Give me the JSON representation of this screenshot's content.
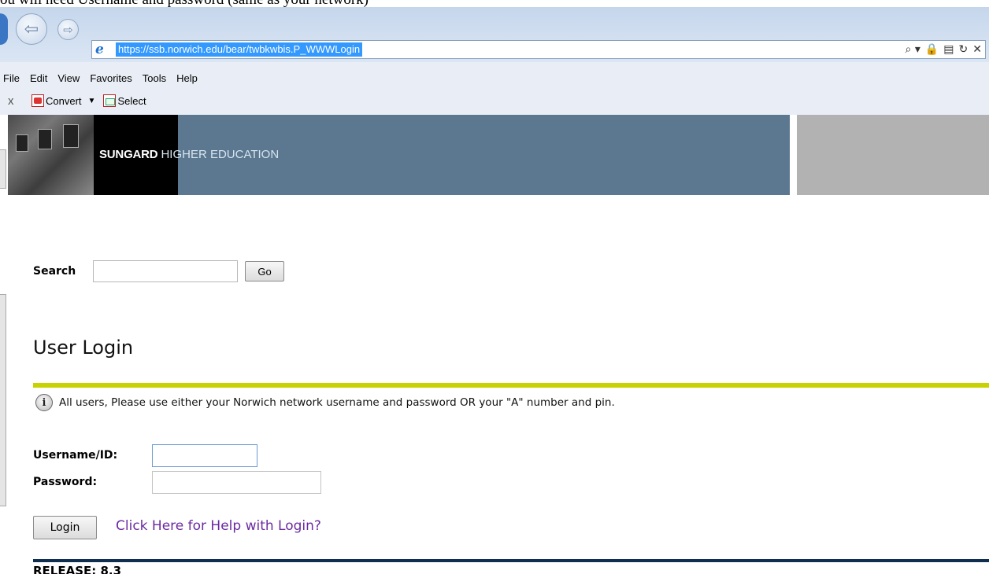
{
  "document_strip": {
    "text": "ou will need Username and password (same as your network)"
  },
  "browser": {
    "url": "https://ssb.norwich.edu/bear/twbkwbis.P_WWWLogin",
    "address_tools": [
      "⌕ ▾",
      "🔒",
      "▤",
      "↻",
      "✕"
    ],
    "menu": [
      "File",
      "Edit",
      "View",
      "Favorites",
      "Tools",
      "Help"
    ],
    "command_bar": {
      "close": "x",
      "convert_label": "Convert",
      "select_label": "Select"
    }
  },
  "banner": {
    "brand_bold": "SUNGARD",
    "brand_sub": "HIGHER EDUCATION"
  },
  "search": {
    "label": "Search",
    "value": "",
    "go_label": "Go"
  },
  "login": {
    "title": "User Login",
    "info": "All users, Please use either your Norwich network username and password OR your \"A\" number and pin.",
    "username_label": "Username/ID:",
    "username_value": "",
    "password_label": "Password:",
    "password_value": "",
    "login_label": "Login",
    "help_link": "Click Here for Help with Login?"
  },
  "footer": {
    "release": "RELEASE: 8.3"
  },
  "colors": {
    "banner_blue": "#5b7890",
    "title_rule": "#c7d200",
    "footer_rule": "#0f2e50",
    "link": "#6b2aa0",
    "url_highlight": "#3399ff"
  }
}
